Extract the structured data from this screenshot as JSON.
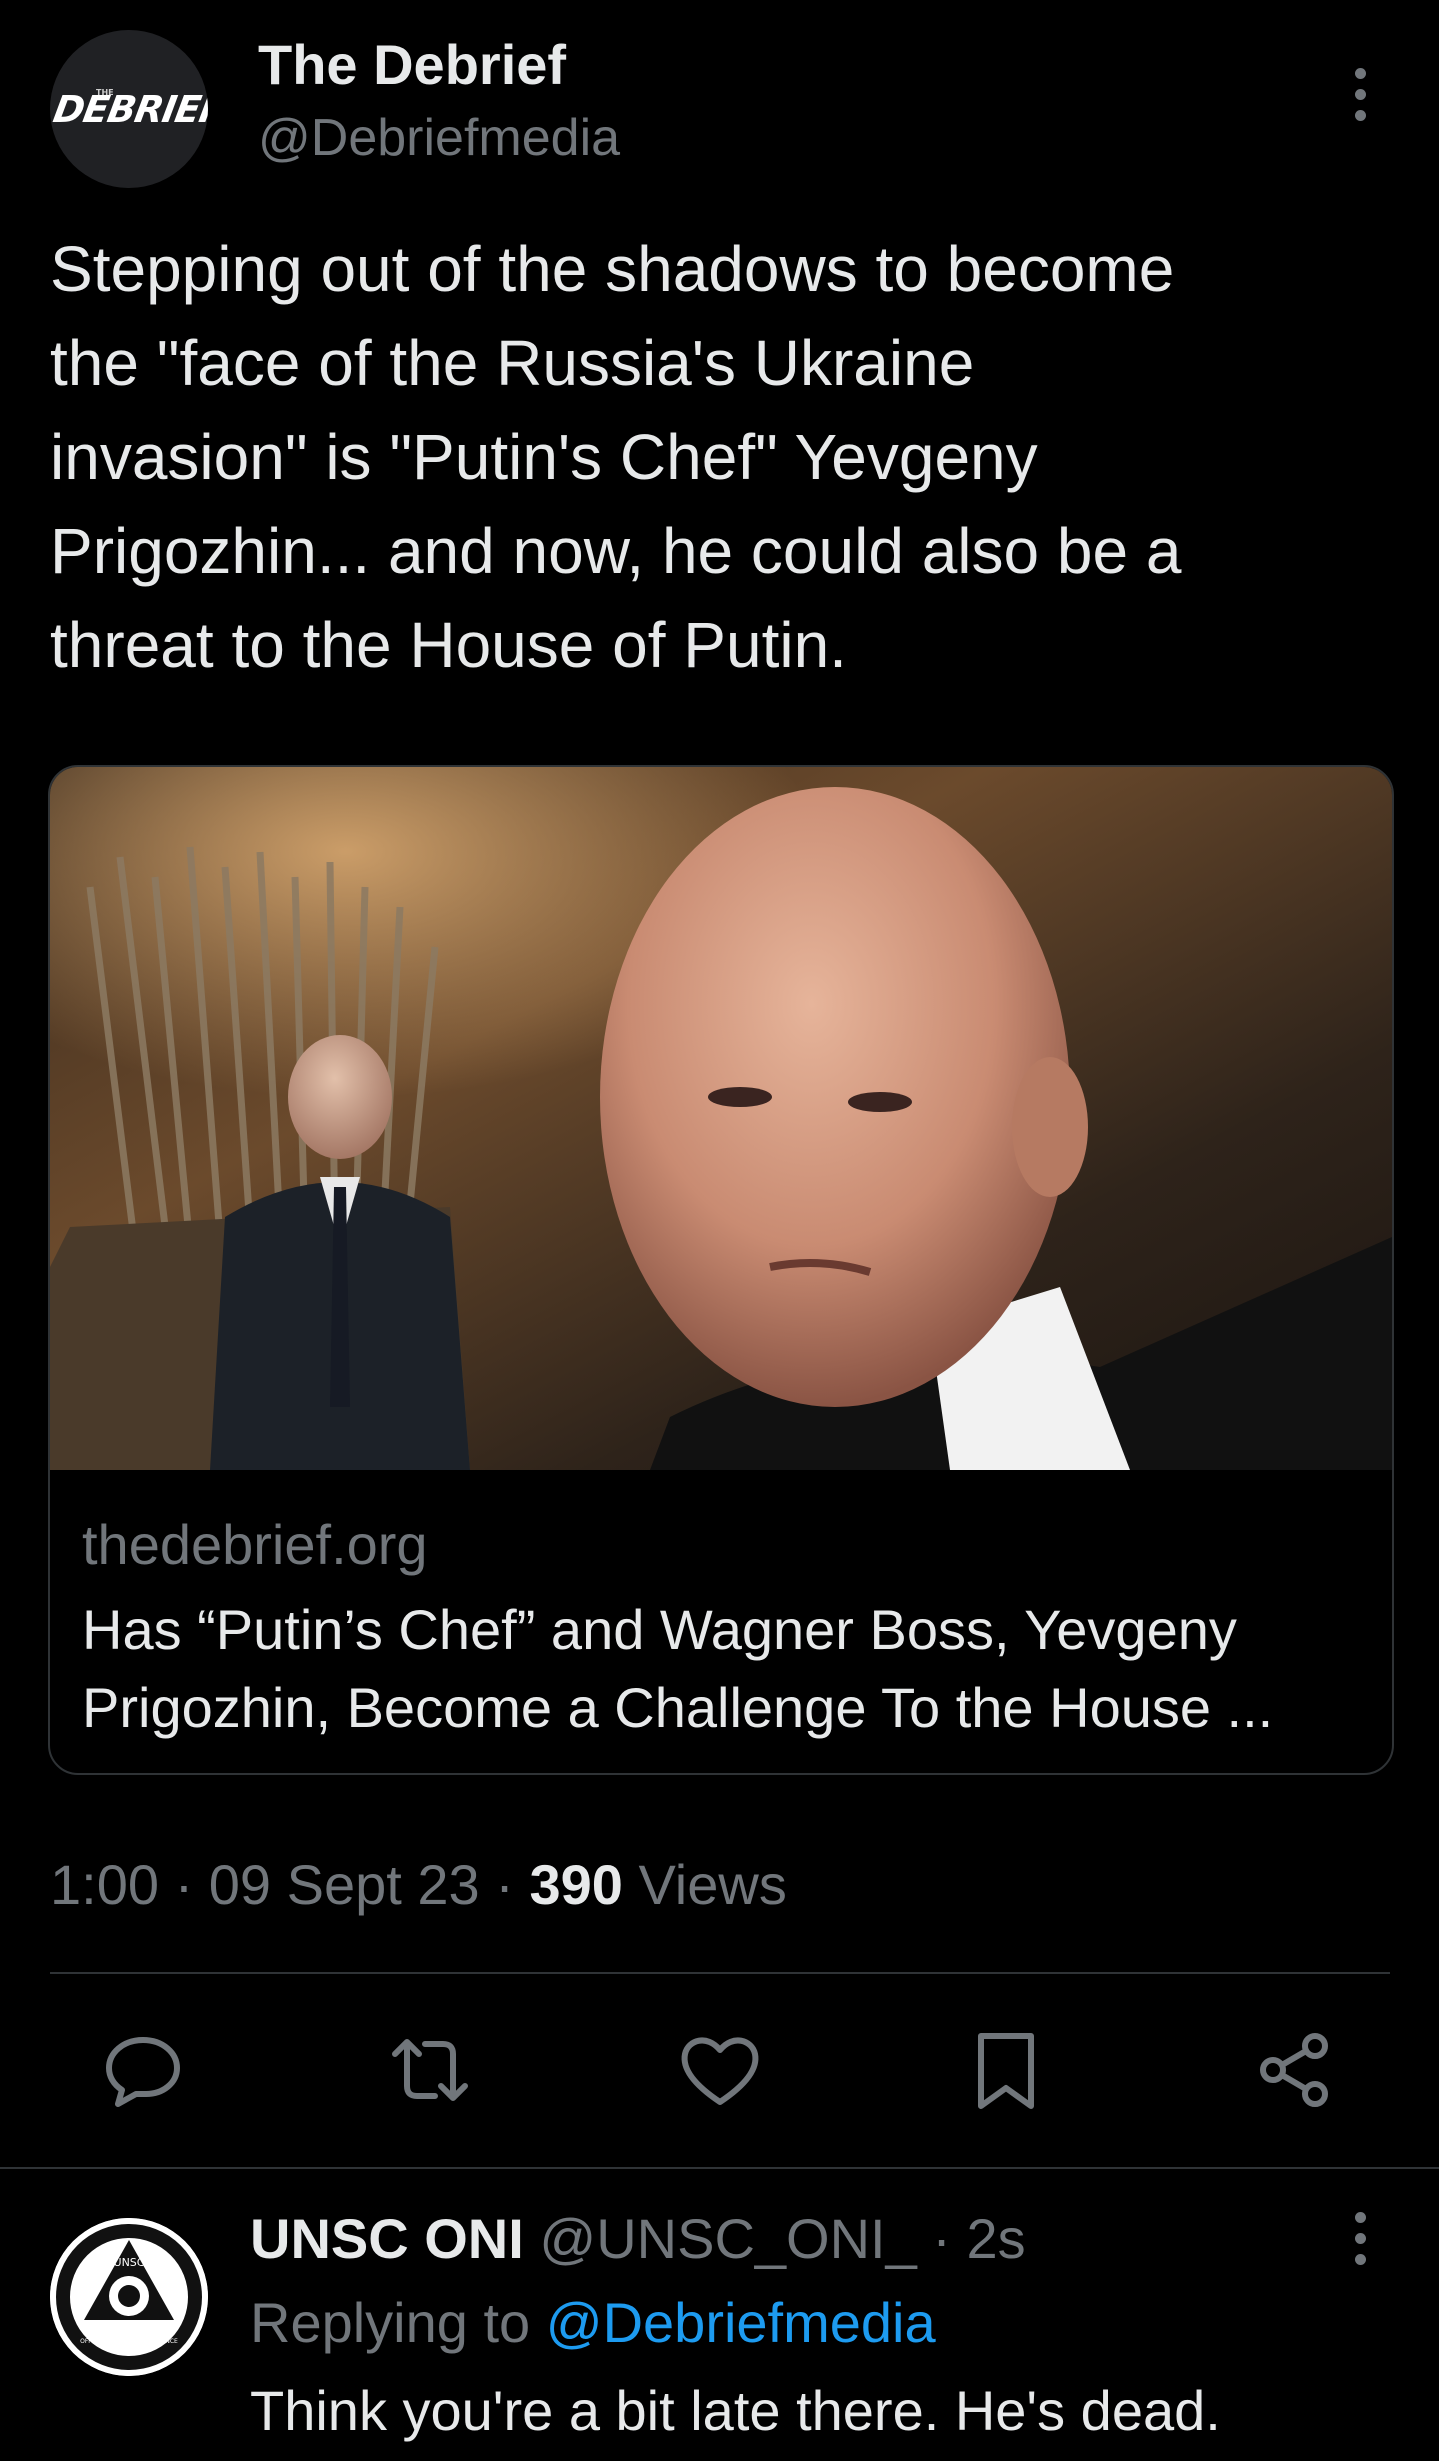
{
  "tweet": {
    "avatar_logo_text": "DEBRIEF",
    "avatar_logo_small": "THE",
    "author_name": "The Debrief",
    "author_handle": "@Debriefmedia",
    "text_lines": [
      "Stepping out of the shadows to become",
      "the \"face of the Russia's Ukraine",
      "invasion\" is \"Putin's Chef\" Yevgeny",
      "Prigozhin... and now, he could also be a",
      "threat to the House of Putin."
    ],
    "card": {
      "domain": "thedebrief.org",
      "title_lines": [
        "Has “Putin’s Chef” and Wagner Boss, Yevgeny",
        "Prigozhin, Become a Challenge To the House ..."
      ]
    },
    "meta": {
      "time": "1:00",
      "date": "09 Sept 23",
      "views_count": "390",
      "views_label": "Views",
      "separator": "·"
    },
    "actions": [
      "reply-icon",
      "retweet-icon",
      "like-icon",
      "bookmark-icon",
      "share-icon"
    ]
  },
  "reply": {
    "author_name": "UNSC ONI",
    "author_handle": "@UNSC_ONI_",
    "age": "· 2s",
    "avatar_text_top": "UNSC",
    "avatar_text_ring": "OFFICE OF NAVAL INTELLIGENCE",
    "replying_label": "Replying to",
    "replying_to": "@Debriefmedia",
    "text": "Think you're a bit late there. He's dead."
  },
  "colors": {
    "background": "#000000",
    "primary_text": "#e7e9ea",
    "secondary_text": "#71767b",
    "link": "#1d9bf0",
    "border": "#2f3336"
  }
}
